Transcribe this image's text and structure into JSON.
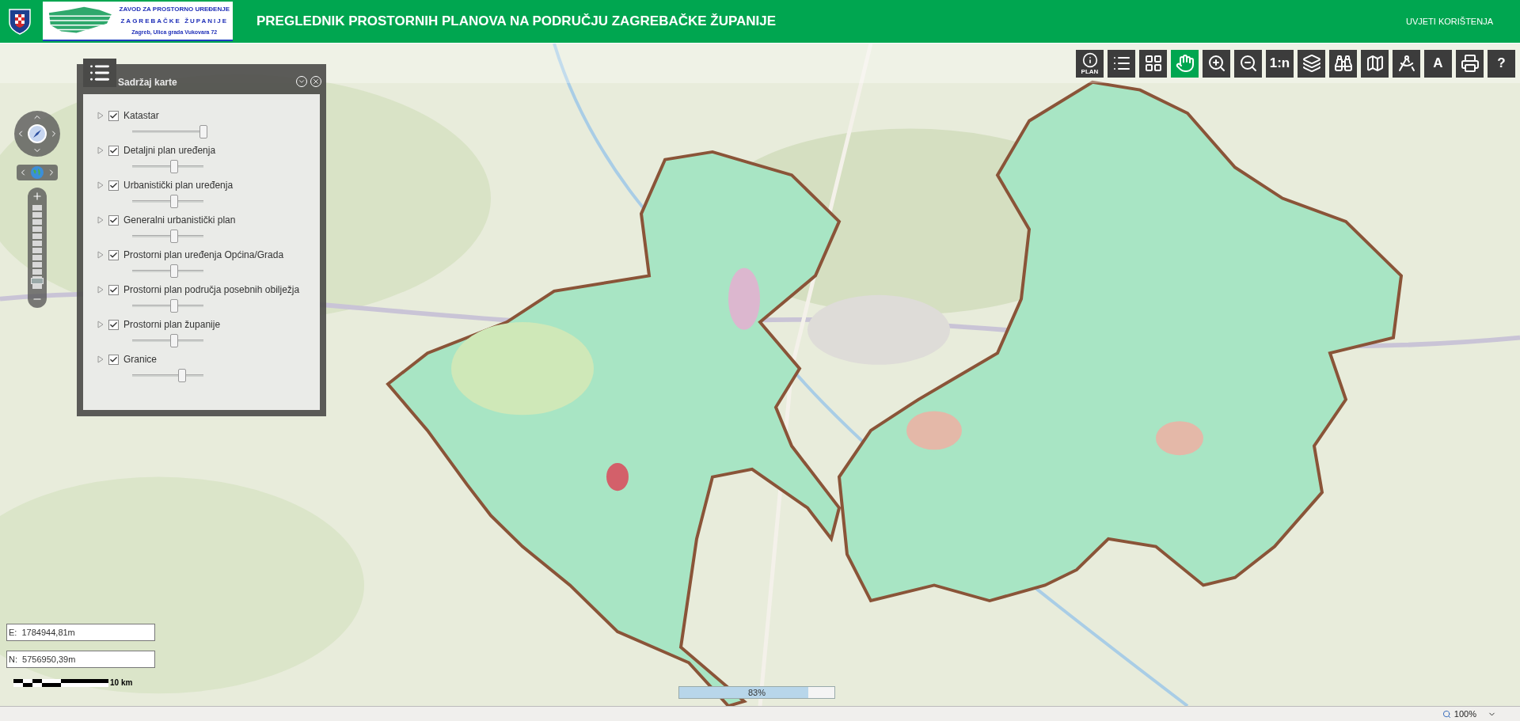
{
  "header": {
    "logo": {
      "lines": [
        "ZAVOD ZA PROSTORNO UREĐENJE",
        "ZAGREBAČKE ŽUPANIJE",
        "Zagreb, Ulica grada Vukovara 72"
      ]
    },
    "title": "PREGLEDNIK PROSTORNIH PLANOVA NA PODRUČJU ZAGREBAČKE ŽUPANIJE",
    "link": "UVJETI KORIŠTENJA"
  },
  "toolbar": [
    {
      "label": "PLAN",
      "selected": false
    },
    {
      "selected": false
    },
    {
      "selected": false
    },
    {
      "selected": true
    },
    {
      "selected": false
    },
    {
      "selected": false
    },
    {
      "label": "1:n",
      "selected": false
    },
    {
      "selected": false
    },
    {
      "selected": false
    },
    {
      "selected": false
    },
    {
      "selected": false
    },
    {
      "label": "A",
      "selected": false
    },
    {
      "selected": false
    },
    {
      "label": "?",
      "selected": false
    }
  ],
  "layers_panel": {
    "title": "Sadržaj karte",
    "layers": [
      {
        "name": "Katastar",
        "checked": true,
        "expanded": false,
        "level": 1.0
      },
      {
        "name": "Detaljni plan uređenja",
        "checked": true,
        "expanded": false,
        "level": 0.59
      },
      {
        "name": "Urbanistički plan uređenja",
        "checked": true,
        "expanded": false,
        "level": 0.59
      },
      {
        "name": "Generalni urbanistički plan",
        "checked": true,
        "expanded": false,
        "level": 0.59
      },
      {
        "name": "Prostorni plan uređenja Općina/Grada",
        "checked": true,
        "expanded": false,
        "level": 0.59
      },
      {
        "name": "Prostorni plan područja posebnih obilježja",
        "checked": true,
        "expanded": false,
        "level": 0.59
      },
      {
        "name": "Prostorni plan županije",
        "checked": true,
        "expanded": false,
        "level": 0.59
      },
      {
        "name": "Granice",
        "checked": true,
        "expanded": false,
        "level": 0.7
      }
    ]
  },
  "zoom_slider": {
    "level": 0.11
  },
  "coordinates": {
    "e": "E:  1784944,81m",
    "n": "N:  5756950,39m"
  },
  "scale_bar": "10 km",
  "progress": {
    "level": 0.83,
    "label": "83%"
  },
  "status_bar": {
    "zoom": "100%"
  }
}
